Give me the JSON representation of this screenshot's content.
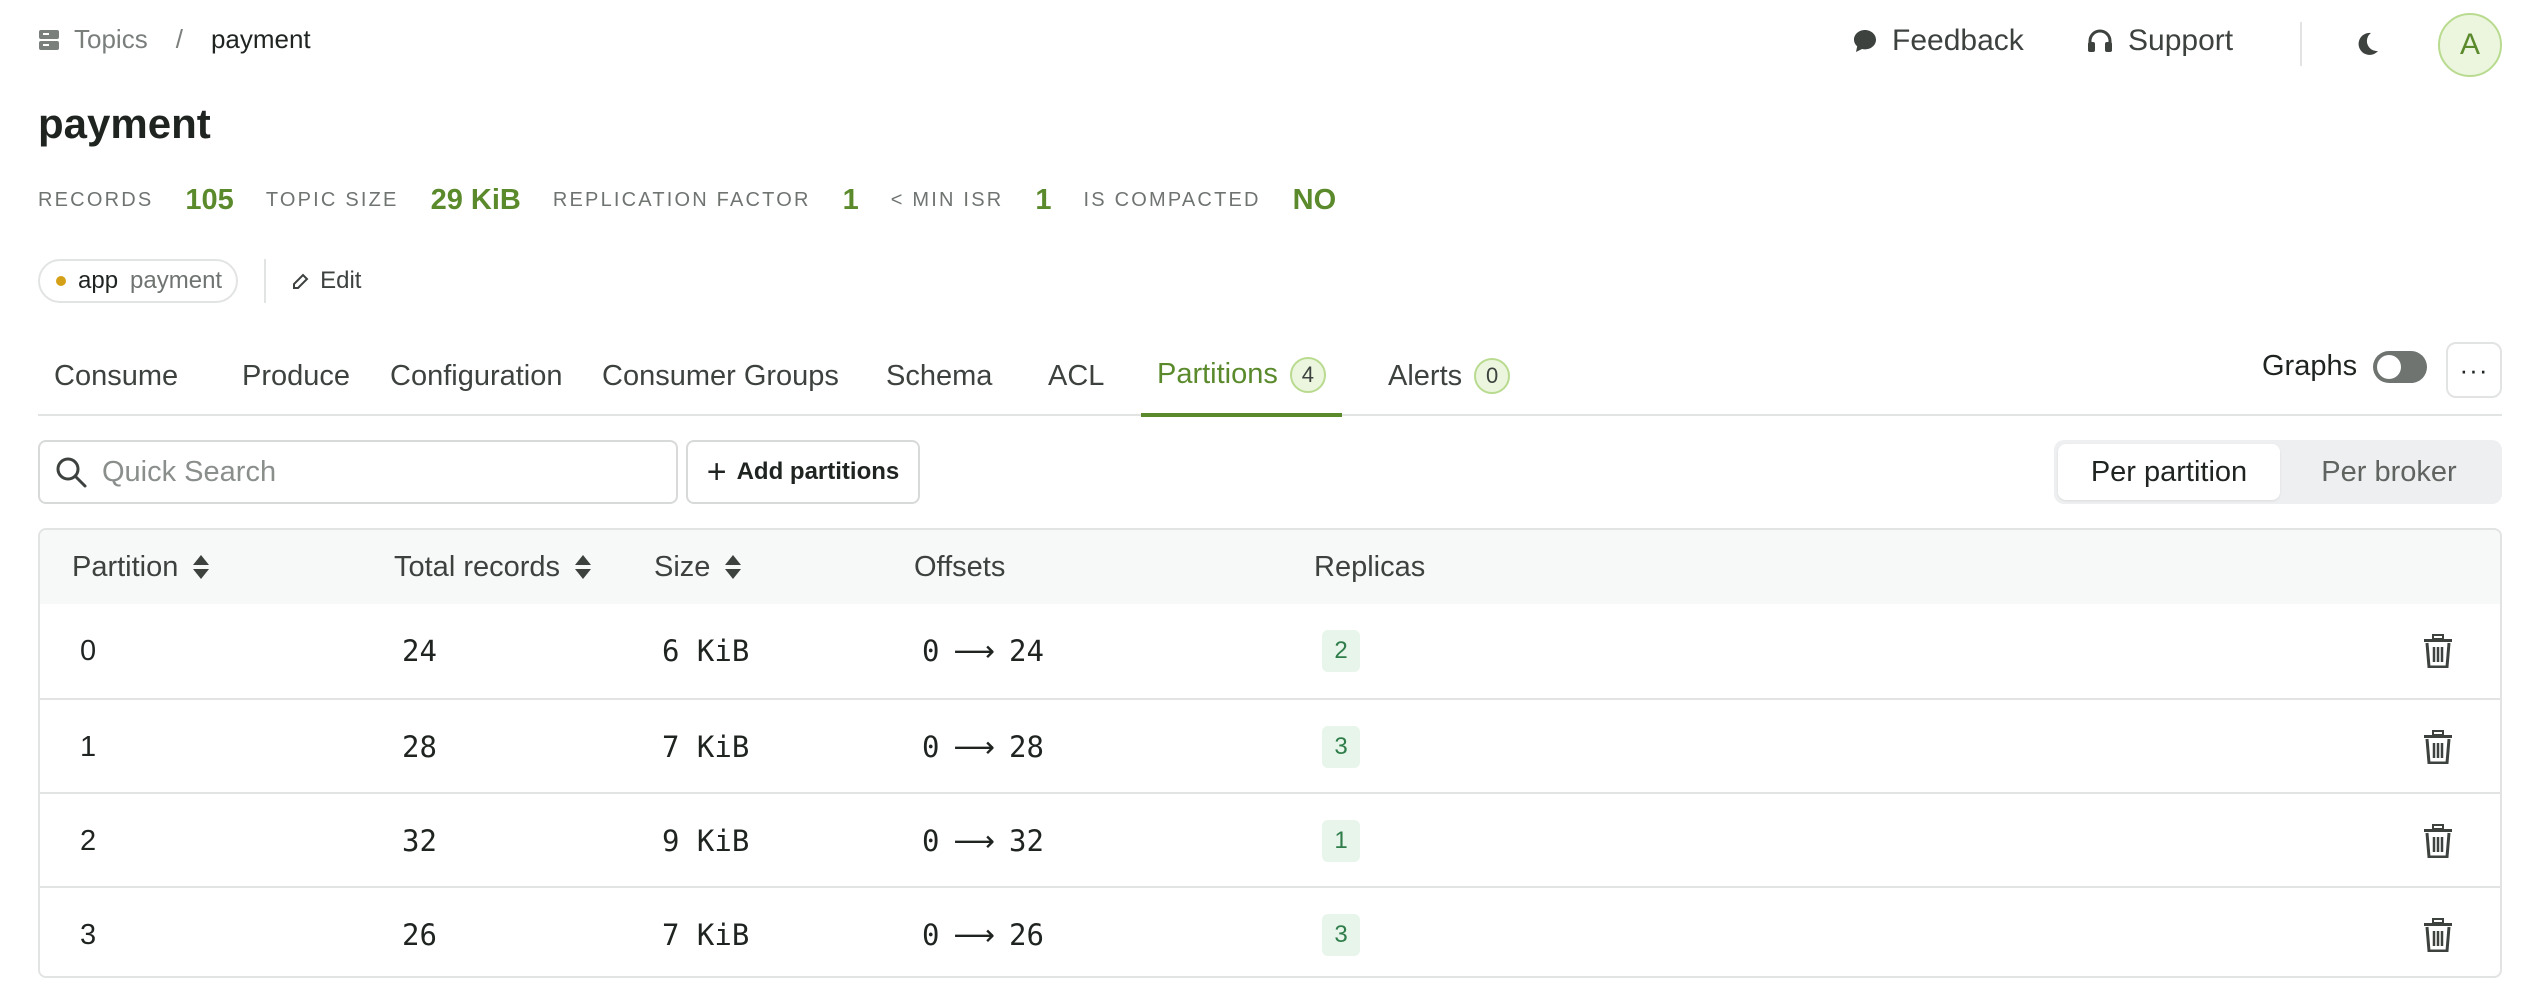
{
  "breadcrumb": {
    "parent": "Topics",
    "separator": "/",
    "current": "payment"
  },
  "header": {
    "feedback": "Feedback",
    "support": "Support",
    "avatar_initial": "A"
  },
  "page": {
    "title": "payment"
  },
  "stats": [
    {
      "label": "RECORDS",
      "value": "105"
    },
    {
      "label": "TOPIC SIZE",
      "value": "29 KiB"
    },
    {
      "label": "REPLICATION FACTOR",
      "value": "1"
    },
    {
      "label": "< MIN ISR",
      "value": "1"
    },
    {
      "label": "IS COMPACTED",
      "value": "NO"
    }
  ],
  "labels": {
    "key": "app",
    "value": "payment",
    "edit": "Edit"
  },
  "tabs": [
    {
      "label": "Consume"
    },
    {
      "label": "Produce"
    },
    {
      "label": "Configuration"
    },
    {
      "label": "Consumer Groups"
    },
    {
      "label": "Schema"
    },
    {
      "label": "ACL"
    },
    {
      "label": "Partitions",
      "badge": "4",
      "active": true
    },
    {
      "label": "Alerts",
      "badge": "0"
    }
  ],
  "graphs": {
    "label": "Graphs",
    "enabled": false
  },
  "more": "···",
  "toolbar": {
    "search_placeholder": "Quick Search",
    "add_partitions": "Add partitions",
    "view_per_partition": "Per partition",
    "view_per_broker": "Per broker",
    "selected_view": "Per partition"
  },
  "table": {
    "columns": [
      "Partition",
      "Total records",
      "Size",
      "Offsets",
      "Replicas"
    ],
    "rows": [
      {
        "partition": "0",
        "total_records": "24",
        "size": "6 KiB",
        "offset_start": "0",
        "offset_arrow": "⟶",
        "offset_end": "24",
        "replicas": "2"
      },
      {
        "partition": "1",
        "total_records": "28",
        "size": "7 KiB",
        "offset_start": "0",
        "offset_arrow": "⟶",
        "offset_end": "28",
        "replicas": "3"
      },
      {
        "partition": "2",
        "total_records": "32",
        "size": "9 KiB",
        "offset_start": "0",
        "offset_arrow": "⟶",
        "offset_end": "32",
        "replicas": "1"
      },
      {
        "partition": "3",
        "total_records": "26",
        "size": "7 KiB",
        "offset_start": "0",
        "offset_arrow": "⟶",
        "offset_end": "26",
        "replicas": "3"
      }
    ]
  },
  "colors": {
    "accent": "#5b8a2c",
    "badge_bg": "#ecf6df",
    "replica_badge_bg": "#e7f5ea",
    "replica_badge_text": "#2f7d4a",
    "label_dot": "#d4a017"
  }
}
